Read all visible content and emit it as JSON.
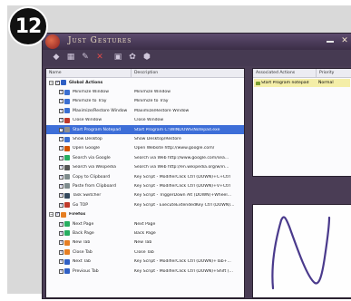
{
  "step_badge": "12",
  "window": {
    "title": "Just Gestures"
  },
  "toolbar": {
    "icons": [
      "add-icon",
      "edit-icon",
      "tools-icon",
      "delete-icon",
      "options-icon",
      "settings-icon",
      "about-icon"
    ]
  },
  "action_list": {
    "columns": {
      "name": "Name",
      "description": "Description"
    },
    "rows": [
      {
        "kind": "group",
        "name": "Global Actions",
        "description": "",
        "color": "#2f5fc4"
      },
      {
        "kind": "item",
        "name": "Minimize Window",
        "description": "Minimize Window",
        "color": "#3b6fd1"
      },
      {
        "kind": "item",
        "name": "Minimize to Tray",
        "description": "Minimize to Tray",
        "color": "#3b6fd1"
      },
      {
        "kind": "item",
        "name": "Maximize/Restore Window",
        "description": "Maximize/Restore Window",
        "color": "#3b6fd1"
      },
      {
        "kind": "item",
        "name": "Close Window",
        "description": "Close Window",
        "color": "#c0392b"
      },
      {
        "kind": "item",
        "name": "Start Program Notepad",
        "description": "Start Program C:\\WINDOWS\\Notepad.exe",
        "color": "#8e8e8e",
        "selected": true
      },
      {
        "kind": "item",
        "name": "Show Desktop",
        "description": "Show Desktop/Restore",
        "color": "#3b6fd1"
      },
      {
        "kind": "item",
        "name": "Open Google",
        "description": "Open Website http://www.google.com/",
        "color": "#d35400"
      },
      {
        "kind": "item",
        "name": "Search via Google",
        "description": "Search via Web http://www.google.com/sea...",
        "color": "#27ae60"
      },
      {
        "kind": "item",
        "name": "Search via Wikipedia",
        "description": "Search via Web http://en.wikipedia.org/w/in...",
        "color": "#555555"
      },
      {
        "kind": "item",
        "name": "Copy to Clipboard",
        "description": "Key Script - ModifierClick Ctrl (DOWN)+C+Ctrl",
        "color": "#7f8c8d"
      },
      {
        "kind": "item",
        "name": "Paste from Clipboard",
        "description": "Key Script - ModifierClick Ctrl (DOWN)+V+Ctrl",
        "color": "#7f8c8d"
      },
      {
        "kind": "item",
        "name": "Task Switcher",
        "description": "Key Script - TriggerDown Alt (DOWN)+Wheel...",
        "color": "#34495e"
      },
      {
        "kind": "item",
        "name": "Go TOP",
        "description": "Key Script - ExecuteExtendedKey Ctrl (DOWN)...",
        "color": "#c0392b"
      },
      {
        "kind": "group",
        "name": "Firefox",
        "description": "",
        "color": "#e67e22"
      },
      {
        "kind": "item",
        "name": "Next Page",
        "description": "Next Page",
        "color": "#27ae60"
      },
      {
        "kind": "item",
        "name": "Back Page",
        "description": "Back Page",
        "color": "#27ae60"
      },
      {
        "kind": "item",
        "name": "New Tab",
        "description": "New Tab",
        "color": "#e67e22"
      },
      {
        "kind": "item",
        "name": "Close Tab",
        "description": "Close Tab",
        "color": "#e67e22"
      },
      {
        "kind": "item",
        "name": "Next Tab",
        "description": "Key Script - ModifierClick Ctrl (DOWN)+Tab+...",
        "color": "#2f5fc4"
      },
      {
        "kind": "item",
        "name": "Previous Tab",
        "description": "Key Script - ModifierClick Ctrl (DOWN)+Shift (...",
        "color": "#2f5fc4"
      }
    ]
  },
  "associated": {
    "columns": {
      "actions": "Associated Actions",
      "priority": "Priority"
    },
    "rows": [
      {
        "action": "Start Program notepad",
        "priority": "Normal"
      }
    ]
  },
  "gesture_preview": {
    "stroke_color": "#4a3a8c"
  }
}
